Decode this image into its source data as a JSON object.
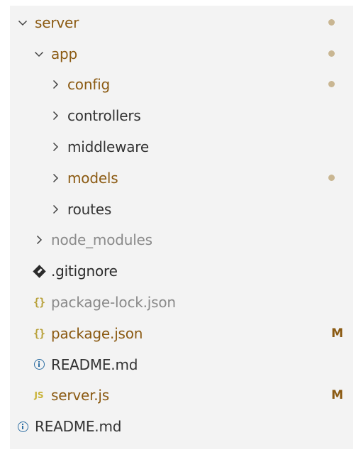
{
  "colors": {
    "panel_background": "#f3f3f3",
    "modified_text": "#8b5a12",
    "normal_text": "#333333",
    "ignored_text": "#8a8a8a",
    "modified_dot": "#c9b692",
    "badge_m": "#8b5a12",
    "json_icon": "#b8a13a",
    "info_icon": "#2f6fa3",
    "js_icon": "#c8b235"
  },
  "tree": [
    {
      "name": "server",
      "kind": "folder",
      "expanded": true,
      "depth": 0,
      "status": "modified",
      "icon": "chevron-down-icon",
      "decoration": "dot"
    },
    {
      "name": "app",
      "kind": "folder",
      "expanded": true,
      "depth": 1,
      "status": "modified",
      "icon": "chevron-down-icon",
      "decoration": "dot"
    },
    {
      "name": "config",
      "kind": "folder",
      "expanded": false,
      "depth": 2,
      "status": "modified",
      "icon": "chevron-right-icon",
      "decoration": "dot"
    },
    {
      "name": "controllers",
      "kind": "folder",
      "expanded": false,
      "depth": 2,
      "status": "normal",
      "icon": "chevron-right-icon"
    },
    {
      "name": "middleware",
      "kind": "folder",
      "expanded": false,
      "depth": 2,
      "status": "normal",
      "icon": "chevron-right-icon"
    },
    {
      "name": "models",
      "kind": "folder",
      "expanded": false,
      "depth": 2,
      "status": "modified",
      "icon": "chevron-right-icon",
      "decoration": "dot"
    },
    {
      "name": "routes",
      "kind": "folder",
      "expanded": false,
      "depth": 2,
      "status": "normal",
      "icon": "chevron-right-icon"
    },
    {
      "name": "node_modules",
      "kind": "folder",
      "expanded": false,
      "depth": 1,
      "status": "ignored",
      "icon": "chevron-right-icon"
    },
    {
      "name": ".gitignore",
      "kind": "file",
      "depth": 1,
      "status": "gitignore",
      "icon": "git-icon"
    },
    {
      "name": "package-lock.json",
      "kind": "file",
      "depth": 1,
      "status": "ignored",
      "icon": "json-icon"
    },
    {
      "name": "package.json",
      "kind": "file",
      "depth": 1,
      "status": "modified",
      "icon": "json-icon",
      "badge": "M"
    },
    {
      "name": "README.md",
      "kind": "file",
      "depth": 1,
      "status": "normal",
      "icon": "info-icon"
    },
    {
      "name": "server.js",
      "kind": "file",
      "depth": 1,
      "status": "modified",
      "icon": "js-icon",
      "badge": "M"
    },
    {
      "name": "README.md",
      "kind": "file",
      "depth": 0,
      "status": "normal",
      "icon": "info-icon"
    }
  ],
  "icon_glyphs": {
    "json": "{}",
    "js": "JS"
  }
}
